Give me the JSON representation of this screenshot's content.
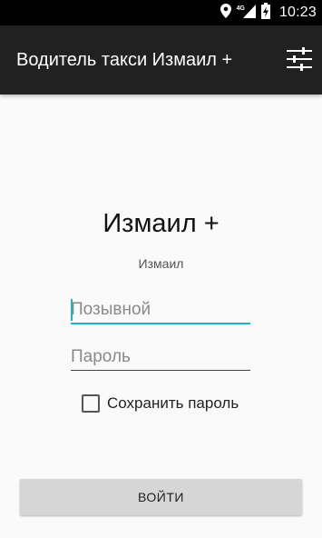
{
  "status_bar": {
    "time": "10:23",
    "network_type": "4G",
    "icons": [
      "location-icon",
      "signal-icon",
      "battery-charging-icon"
    ]
  },
  "app_bar": {
    "title": "Водитель такси Измаил +",
    "action_icon": "settings-sliders-icon"
  },
  "login": {
    "heading": "Измаил +",
    "subheading": "Измаил",
    "callsign": {
      "placeholder": "Позывной",
      "value": ""
    },
    "password": {
      "placeholder": "Пароль",
      "value": ""
    },
    "save_password": {
      "label": "Сохранить пароль",
      "checked": false
    },
    "submit_label": "ВОЙТИ"
  },
  "colors": {
    "status_bar_bg": "#000000",
    "app_bar_bg": "#212121",
    "background": "#fafafa",
    "accent": "#1eb3c8",
    "button_bg": "#d6d6d6"
  }
}
